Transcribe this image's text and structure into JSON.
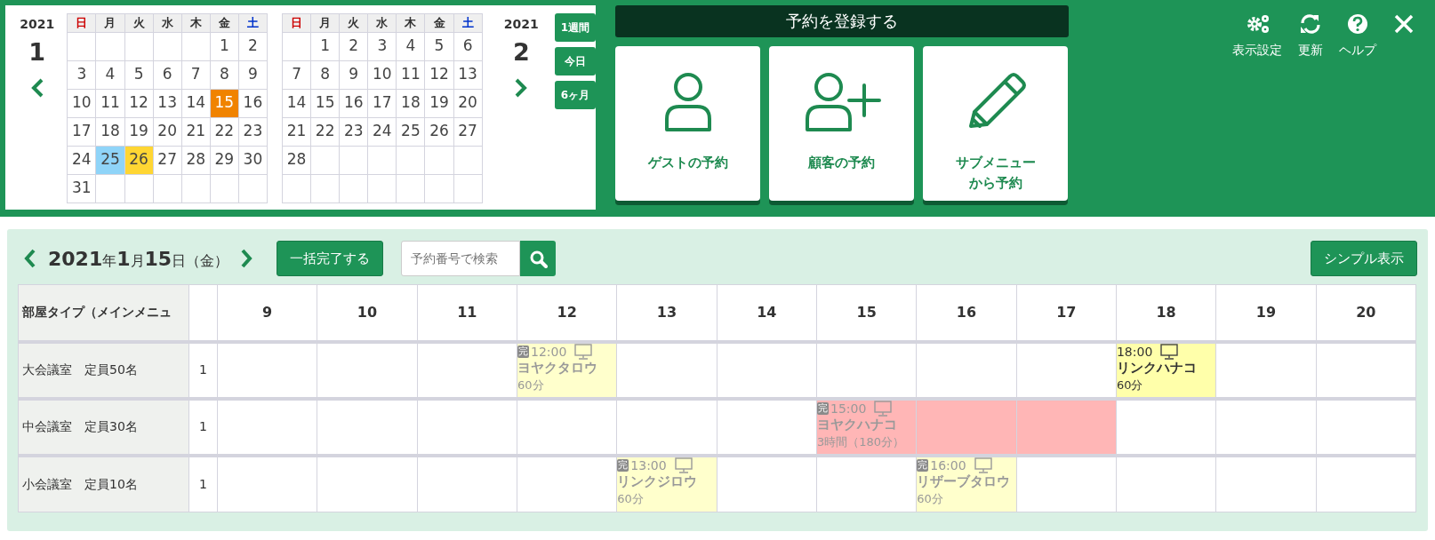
{
  "calendars": [
    {
      "year": "2021",
      "month": "1",
      "weekdays": [
        {
          "label": "日",
          "color": "#cc0000"
        },
        {
          "label": "月",
          "color": "#333333"
        },
        {
          "label": "火",
          "color": "#333333"
        },
        {
          "label": "水",
          "color": "#333333"
        },
        {
          "label": "木",
          "color": "#333333"
        },
        {
          "label": "金",
          "color": "#333333"
        },
        {
          "label": "土",
          "color": "#0033cc"
        }
      ],
      "weeks": [
        [
          {
            "kind": "blank"
          },
          {
            "kind": "blank"
          },
          {
            "kind": "blank"
          },
          {
            "kind": "blank"
          },
          {
            "kind": "blank"
          },
          {
            "kind": "day",
            "day": "1"
          },
          {
            "kind": "day",
            "day": "2"
          }
        ],
        [
          {
            "kind": "day",
            "day": "3"
          },
          {
            "kind": "day",
            "day": "4"
          },
          {
            "kind": "day",
            "day": "5"
          },
          {
            "kind": "day",
            "day": "6"
          },
          {
            "kind": "day",
            "day": "7"
          },
          {
            "kind": "day",
            "day": "8"
          },
          {
            "kind": "day",
            "day": "9"
          }
        ],
        [
          {
            "kind": "day",
            "day": "10"
          },
          {
            "kind": "day",
            "day": "11"
          },
          {
            "kind": "day",
            "day": "12"
          },
          {
            "kind": "day",
            "day": "13"
          },
          {
            "kind": "day",
            "day": "14"
          },
          {
            "kind": "day",
            "day": "15",
            "color": "#f08300"
          },
          {
            "kind": "day",
            "day": "16"
          }
        ],
        [
          {
            "kind": "day",
            "day": "17"
          },
          {
            "kind": "day",
            "day": "18"
          },
          {
            "kind": "day",
            "day": "19"
          },
          {
            "kind": "day",
            "day": "20"
          },
          {
            "kind": "day",
            "day": "21"
          },
          {
            "kind": "day",
            "day": "22"
          },
          {
            "kind": "day",
            "day": "23"
          }
        ],
        [
          {
            "kind": "day",
            "day": "24"
          },
          {
            "kind": "day",
            "day": "25",
            "color": "#8fd4f8"
          },
          {
            "kind": "day",
            "day": "26",
            "color": "#ffd633"
          },
          {
            "kind": "day",
            "day": "27"
          },
          {
            "kind": "day",
            "day": "28"
          },
          {
            "kind": "day",
            "day": "29"
          },
          {
            "kind": "day",
            "day": "30"
          }
        ],
        [
          {
            "kind": "day",
            "day": "31"
          },
          {
            "kind": "blank"
          },
          {
            "kind": "blank"
          },
          {
            "kind": "blank"
          },
          {
            "kind": "blank"
          },
          {
            "kind": "blank"
          },
          {
            "kind": "blank"
          }
        ]
      ]
    },
    {
      "year": "2021",
      "month": "2",
      "weekdays": [
        {
          "label": "日",
          "color": "#cc0000"
        },
        {
          "label": "月",
          "color": "#333333"
        },
        {
          "label": "火",
          "color": "#333333"
        },
        {
          "label": "水",
          "color": "#333333"
        },
        {
          "label": "木",
          "color": "#333333"
        },
        {
          "label": "金",
          "color": "#333333"
        },
        {
          "label": "土",
          "color": "#0033cc"
        }
      ],
      "weeks": [
        [
          {
            "kind": "blank"
          },
          {
            "kind": "day",
            "day": "1"
          },
          {
            "kind": "day",
            "day": "2"
          },
          {
            "kind": "day",
            "day": "3"
          },
          {
            "kind": "day",
            "day": "4"
          },
          {
            "kind": "day",
            "day": "5"
          },
          {
            "kind": "day",
            "day": "6"
          }
        ],
        [
          {
            "kind": "day",
            "day": "7"
          },
          {
            "kind": "day",
            "day": "8"
          },
          {
            "kind": "day",
            "day": "9"
          },
          {
            "kind": "day",
            "day": "10"
          },
          {
            "kind": "day",
            "day": "11"
          },
          {
            "kind": "day",
            "day": "12"
          },
          {
            "kind": "day",
            "day": "13"
          }
        ],
        [
          {
            "kind": "day",
            "day": "14"
          },
          {
            "kind": "day",
            "day": "15"
          },
          {
            "kind": "day",
            "day": "16"
          },
          {
            "kind": "day",
            "day": "17"
          },
          {
            "kind": "day",
            "day": "18"
          },
          {
            "kind": "day",
            "day": "19"
          },
          {
            "kind": "day",
            "day": "20"
          }
        ],
        [
          {
            "kind": "day",
            "day": "21"
          },
          {
            "kind": "day",
            "day": "22"
          },
          {
            "kind": "day",
            "day": "23"
          },
          {
            "kind": "day",
            "day": "24"
          },
          {
            "kind": "day",
            "day": "25"
          },
          {
            "kind": "day",
            "day": "26"
          },
          {
            "kind": "day",
            "day": "27"
          }
        ],
        [
          {
            "kind": "day",
            "day": "28"
          },
          {
            "kind": "blank"
          },
          {
            "kind": "blank"
          },
          {
            "kind": "blank"
          },
          {
            "kind": "blank"
          },
          {
            "kind": "blank"
          },
          {
            "kind": "blank"
          }
        ],
        [
          {
            "kind": "blank"
          },
          {
            "kind": "blank"
          },
          {
            "kind": "blank"
          },
          {
            "kind": "blank"
          },
          {
            "kind": "blank"
          },
          {
            "kind": "blank"
          },
          {
            "kind": "blank"
          }
        ]
      ]
    }
  ],
  "range_buttons": [
    "1週間",
    "今日",
    "6ヶ月"
  ],
  "register": {
    "title": "予約を登録する",
    "cards": [
      {
        "kind": "guest",
        "lines": [
          "ゲストの予約"
        ]
      },
      {
        "kind": "customer",
        "lines": [
          "顧客の予約"
        ]
      },
      {
        "kind": "submenu",
        "lines": [
          "サブメニュー",
          "から予約"
        ]
      }
    ]
  },
  "tools": [
    {
      "kind": "settings",
      "label": "表示設定"
    },
    {
      "kind": "refresh",
      "label": "更新"
    },
    {
      "kind": "help",
      "label": "ヘルプ"
    },
    {
      "kind": "close"
    }
  ],
  "schedule": {
    "date": "**2021**年**1**月**15**日（金）",
    "bulk_button": "一括完了する",
    "search": {
      "placeholder": "予約番号で検索"
    },
    "simple_button": "シンプル表示",
    "header": "部屋タイプ（メインメニュ",
    "hours": [
      "9",
      "10",
      "11",
      "12",
      "13",
      "14",
      "15",
      "16",
      "17",
      "18",
      "19",
      "20"
    ],
    "rows": [
      {
        "room": "大会議室　定員50名",
        "count": "1",
        "cells": [
          {
            "kind": "empty"
          },
          {
            "kind": "empty"
          },
          {
            "kind": "empty"
          },
          {
            "kind": "booking",
            "done": true,
            "badge": "完",
            "color": "#ffffcc",
            "time": "12:00",
            "name": "ヨヤクタロウ",
            "duration": "60分"
          },
          {
            "kind": "empty"
          },
          {
            "kind": "empty"
          },
          {
            "kind": "empty"
          },
          {
            "kind": "empty"
          },
          {
            "kind": "empty"
          },
          {
            "kind": "booking",
            "done": false,
            "color": "#ffffaa",
            "time": "18:00",
            "name": "リンクハナコ",
            "duration": "60分"
          },
          {
            "kind": "empty"
          },
          {
            "kind": "empty"
          }
        ]
      },
      {
        "room": "中会議室　定員30名",
        "count": "1",
        "cells": [
          {
            "kind": "empty"
          },
          {
            "kind": "empty"
          },
          {
            "kind": "empty"
          },
          {
            "kind": "empty"
          },
          {
            "kind": "empty"
          },
          {
            "kind": "empty"
          },
          {
            "kind": "booking",
            "done": true,
            "badge": "完",
            "color": "#ffb6b6",
            "time": "15:00",
            "name": "ヨヤクハナコ",
            "duration": "3時間（180分）"
          },
          {
            "kind": "continued",
            "color": "#ffb6b6"
          },
          {
            "kind": "continued",
            "color": "#ffb6b6"
          },
          {
            "kind": "empty"
          },
          {
            "kind": "empty"
          },
          {
            "kind": "empty"
          }
        ]
      },
      {
        "room": "小会議室　定員10名",
        "count": "1",
        "cells": [
          {
            "kind": "empty"
          },
          {
            "kind": "empty"
          },
          {
            "kind": "empty"
          },
          {
            "kind": "empty"
          },
          {
            "kind": "booking",
            "done": true,
            "badge": "完",
            "color": "#ffffcc",
            "time": "13:00",
            "name": "リンクジロウ",
            "duration": "60分"
          },
          {
            "kind": "empty"
          },
          {
            "kind": "empty"
          },
          {
            "kind": "booking",
            "done": true,
            "badge": "完",
            "color": "#ffffcc",
            "time": "16:00",
            "name": "リザーブタロウ",
            "duration": "60分"
          },
          {
            "kind": "empty"
          },
          {
            "kind": "empty"
          },
          {
            "kind": "empty"
          },
          {
            "kind": "empty"
          }
        ]
      }
    ]
  }
}
